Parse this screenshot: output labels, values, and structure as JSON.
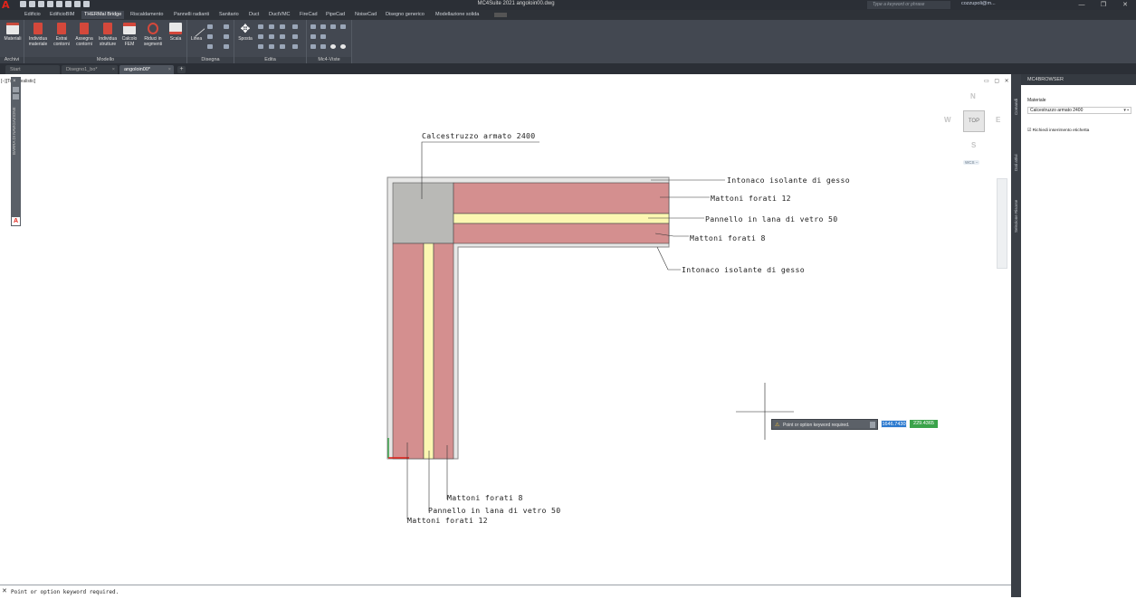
{
  "app": {
    "title": "MC4Suite 2021   angoloin00.dwg",
    "logo": "A",
    "search_placeholder": "Type a keyword or phrase",
    "user": "cozzupoli@m...",
    "window_controls": [
      "—",
      "❐",
      "✕"
    ]
  },
  "ribbon_tabs": [
    {
      "label": "Edificio"
    },
    {
      "label": "EdificioBIM"
    },
    {
      "label": "THERMal Bridge",
      "active": true
    },
    {
      "label": "Riscaldamento"
    },
    {
      "label": "Pannelli radianti"
    },
    {
      "label": "Sanitario"
    },
    {
      "label": "Duct"
    },
    {
      "label": "DuctVMC"
    },
    {
      "label": "FireCad"
    },
    {
      "label": "PipeCad"
    },
    {
      "label": "NoiseCad"
    },
    {
      "label": "Disegno generico"
    },
    {
      "label": "Modellazione solida"
    }
  ],
  "ribbon": {
    "panels": [
      {
        "title": "Archivi",
        "tools": [
          {
            "label": "Materiali"
          }
        ]
      },
      {
        "title": "Modello",
        "tools": [
          {
            "label": "Individua materiale"
          },
          {
            "label": "Estrai contorni"
          },
          {
            "label": "Assegna contorni"
          },
          {
            "label": "Individua strutture"
          },
          {
            "label": "Calcolo FEM"
          },
          {
            "label": "Riduci in segmenti"
          },
          {
            "label": "Scala"
          }
        ]
      },
      {
        "title": "Disegna",
        "tools": [
          {
            "label": "Linea"
          }
        ]
      },
      {
        "title": "Edita",
        "tools": [
          {
            "label": "Sposta"
          }
        ]
      },
      {
        "title": "Mc4-Viste",
        "tools": []
      }
    ]
  },
  "doc_tabs": [
    {
      "label": "Start"
    },
    {
      "label": "Disegno1_bo*"
    },
    {
      "label": "angoloin00*",
      "active": true
    }
  ],
  "viewport": {
    "label": "[−][Top][Realistic]",
    "nav_bar_label": "BARRA DI NAVIGAZIONE"
  },
  "viewcube": {
    "n": "N",
    "s": "S",
    "w": "W",
    "e": "E",
    "top": "TOP",
    "wcs": "WCS −"
  },
  "drawing_labels": {
    "calcestruzzo": "Calcestruzzo armato 2400",
    "intonaco_top": "Intonaco isolante di gesso",
    "mattoni12_top": "Mattoni forati 12",
    "pannello_top": "Pannello in lana di vetro 50",
    "mattoni8_top": "Mattoni forati 8",
    "intonaco_right": "Intonaco isolante di gesso",
    "mattoni8_bottom": "Mattoni forati 8",
    "pannello_bottom": "Pannello in lana di vetro 50",
    "mattoni12_bottom": "Mattoni forati 12"
  },
  "colors": {
    "brick": "#d48f8f",
    "concrete": "#b9b9b6",
    "plaster": "#e7e7e6",
    "insulation": "#fcf7b2",
    "accent_blue": "#2b79cf",
    "accent_green": "#3aa34a"
  },
  "dynamic_input": {
    "prompt": "Point or option keyword required.",
    "x": "1646.7430",
    "y": "229.4365"
  },
  "side_tabs": [
    "Comandi",
    "Dati attivi",
    "Selezione Risorse"
  ],
  "browser": {
    "title": "MC4BROWSER",
    "material_label": "Materiale",
    "material_value": "Calcestruzzo armato 2400",
    "checkbox_label": "Richiedi inserimento etichetta"
  },
  "command_line": "Point or option keyword required."
}
